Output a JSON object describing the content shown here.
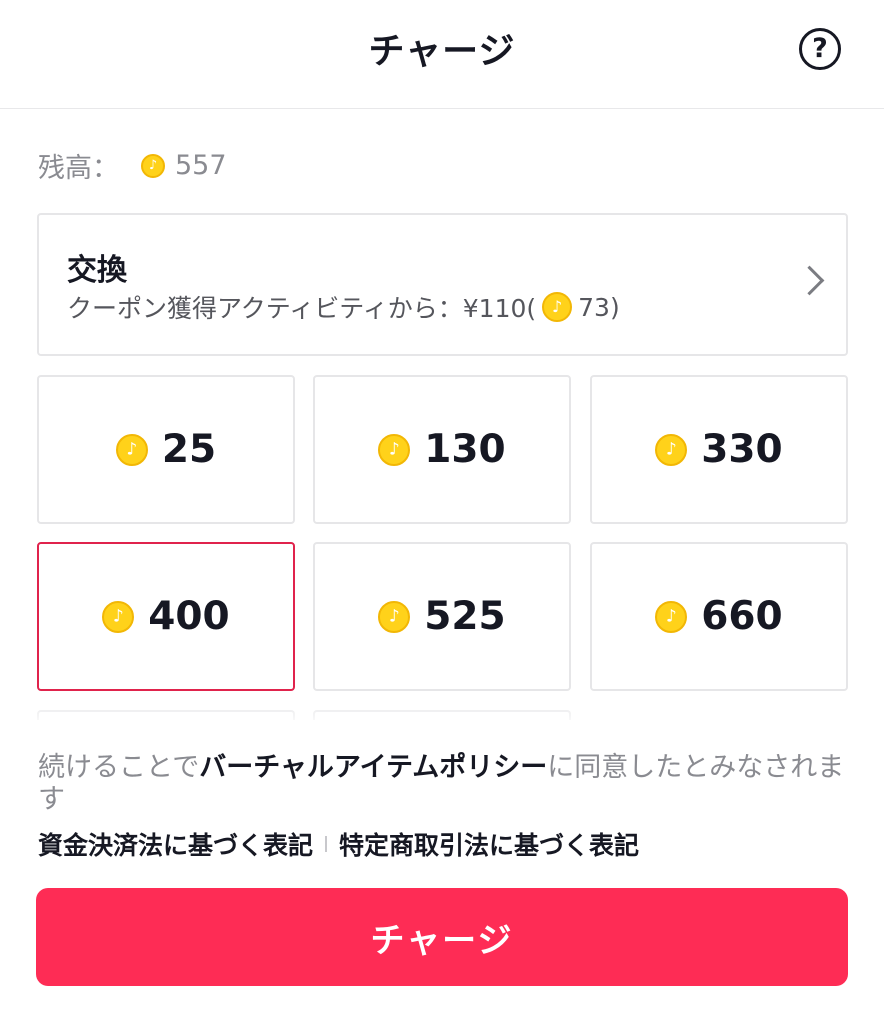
{
  "header": {
    "title": "チャージ",
    "help_icon": "?"
  },
  "balance": {
    "label": "残高：",
    "value": "557"
  },
  "exchange": {
    "title": "交換",
    "subtitle_prefix": "クーポン獲得アクティビティから：¥110(",
    "subtitle_coins": "73",
    "subtitle_suffix": ")"
  },
  "packages": [
    {
      "amount": "25",
      "selected": false
    },
    {
      "amount": "130",
      "selected": false
    },
    {
      "amount": "330",
      "selected": false
    },
    {
      "amount": "400",
      "selected": true
    },
    {
      "amount": "525",
      "selected": false
    },
    {
      "amount": "660",
      "selected": false
    }
  ],
  "policy": {
    "prefix": "続けることで",
    "link": "バーチャルアイテムポリシー",
    "suffix": "に同意したとみなされます"
  },
  "legal": {
    "payment_services_act": "資金決済法に基づく表記",
    "commercial_transactions_act": "特定商取引法に基づく表記"
  },
  "charge_button": "チャージ",
  "colors": {
    "accent": "#fe2c55",
    "selected_border": "#e0234c",
    "coin": "#ffd21a",
    "text_primary": "#161823",
    "text_secondary": "#8a8b91"
  }
}
